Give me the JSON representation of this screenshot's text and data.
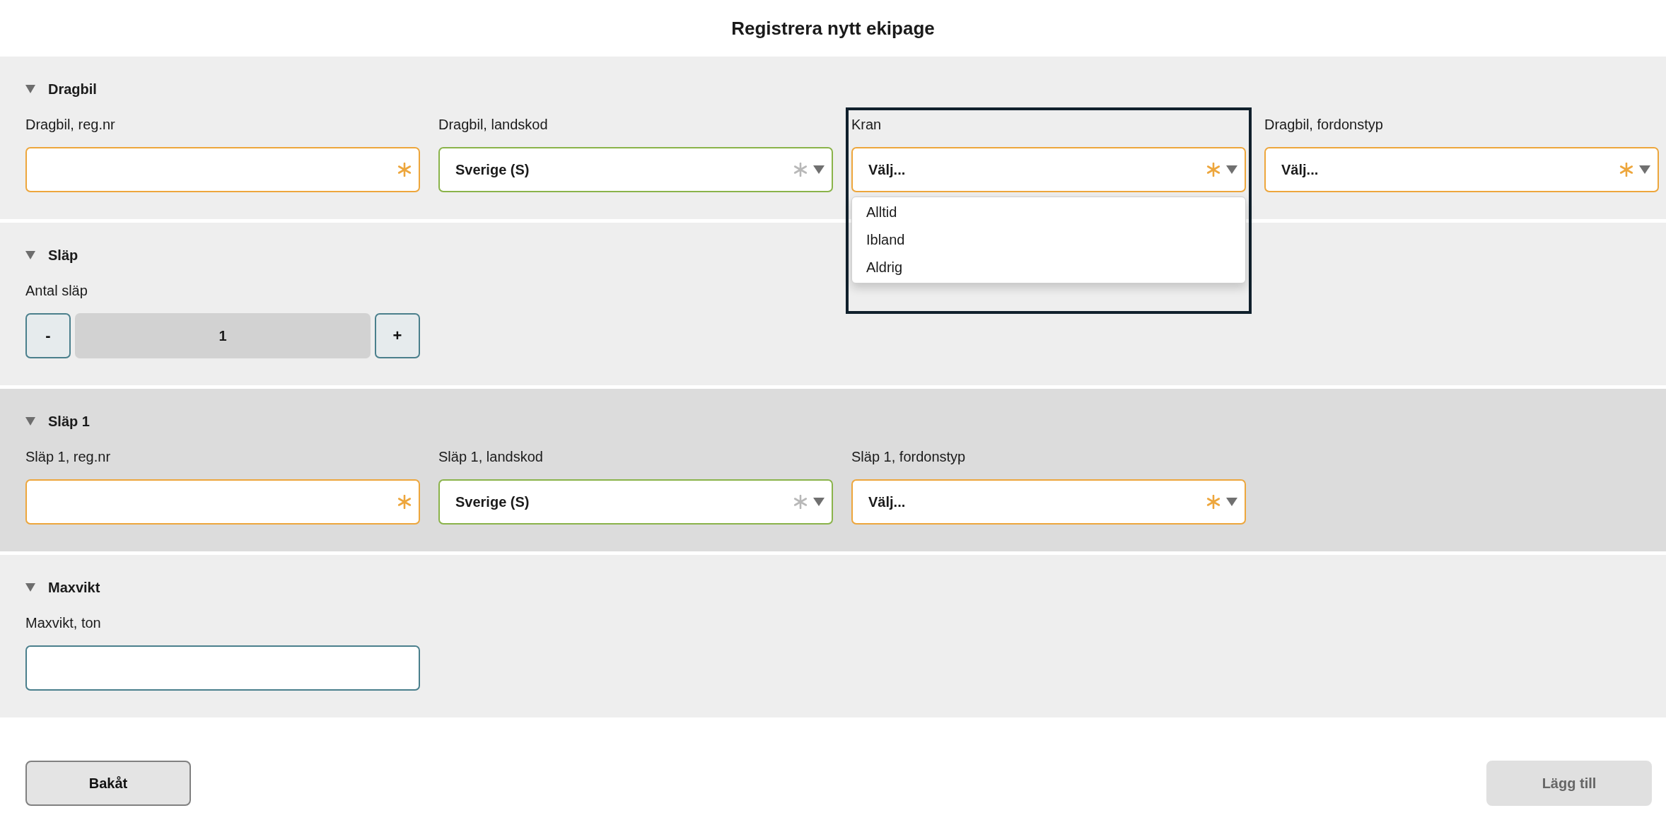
{
  "title": "Registrera nytt ekipage",
  "sections": [
    {
      "title": "Dragbil",
      "expanded": true,
      "highlighted": false,
      "fields": [
        {
          "kind": "text",
          "label": "Dragbil, reg.nr",
          "required": true,
          "valid": false
        },
        {
          "kind": "select",
          "label": "Dragbil, landskod",
          "value": "Sverige (S)",
          "required": true,
          "valid": true
        },
        {
          "kind": "select",
          "label": "Kran",
          "value": "Välj...",
          "required": true,
          "valid": false,
          "focused": true,
          "open": true,
          "options": [
            {
              "label": "Alltid",
              "selected": false
            },
            {
              "label": "Ibland",
              "selected": false
            },
            {
              "label": "Aldrig",
              "selected": false
            }
          ]
        },
        {
          "kind": "select",
          "label": "Dragbil, fordonstyp",
          "value": "Välj...",
          "required": true,
          "valid": false
        }
      ]
    },
    {
      "title": "Släp",
      "expanded": true,
      "highlighted": false,
      "fields": [
        {
          "kind": "stepper",
          "label": "Antal släp",
          "value": "1",
          "minus": "-",
          "plus": "+"
        }
      ]
    },
    {
      "title": "Släp 1",
      "expanded": true,
      "highlighted": true,
      "fields": [
        {
          "kind": "text",
          "label": "Släp 1, reg.nr",
          "required": true,
          "valid": false
        },
        {
          "kind": "select",
          "label": "Släp 1, landskod",
          "value": "Sverige (S)",
          "required": true,
          "valid": true
        },
        {
          "kind": "select",
          "label": "Släp 1, fordonstyp",
          "value": "Välj...",
          "required": true,
          "valid": false
        }
      ]
    },
    {
      "title": "Maxvikt",
      "expanded": true,
      "highlighted": false,
      "fields": [
        {
          "kind": "text",
          "label": "Maxvikt, ton",
          "required": false,
          "valid": false
        }
      ]
    }
  ],
  "buttons": [
    {
      "label": "Bakåt",
      "disabled": false
    },
    {
      "label": "Lägg till",
      "disabled": true
    }
  ]
}
